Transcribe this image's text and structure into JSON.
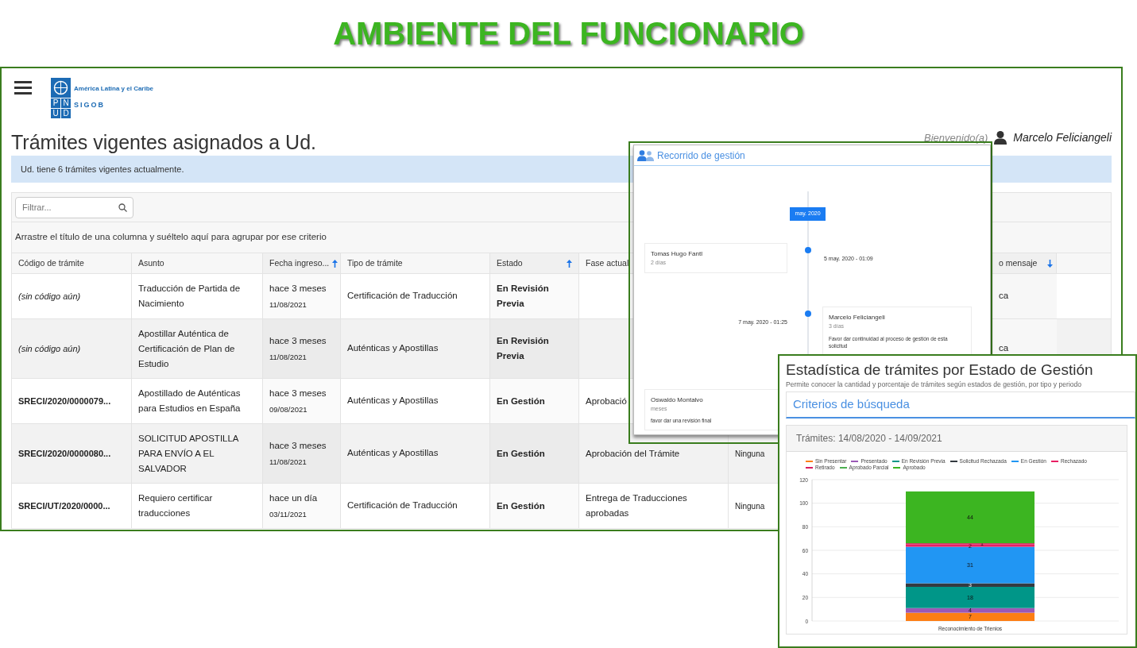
{
  "page_title": "AMBIENTE DEL FUNCIONARIO",
  "main_window": {
    "logo": {
      "letters": [
        "P",
        "N",
        "U",
        "D"
      ],
      "region": "América Latina y el Caribe",
      "brand": "SIGOB"
    },
    "heading": "Trámites vigentes asignados a Ud.",
    "welcome": {
      "greeting": "Bienvenido(a)",
      "user": "Marcelo Feliciangeli"
    },
    "alert": "Ud. tiene 6 trámites vigentes actualmente.",
    "filter": {
      "placeholder": "Filtrar..."
    },
    "group_hint": "Arrastre el título de una columna y suéltelo aquí para agrupar por ese criterio",
    "table": {
      "columns": [
        {
          "label": "Código de trámite",
          "sorted": false
        },
        {
          "label": "Asunto",
          "sorted": false
        },
        {
          "label": "Fecha ingreso...",
          "sorted": true,
          "descending": false
        },
        {
          "label": "Tipo de trámite",
          "sorted": false
        },
        {
          "label": "Estado",
          "sorted": true,
          "descending": false
        },
        {
          "label": "Fase actual"
        },
        {
          "label": "o mensaje",
          "sorted": true,
          "descending": true
        }
      ],
      "rows": [
        {
          "code": {
            "kind": "pending",
            "text": "(sin código aún)"
          },
          "subject": "Traducción de Partida de Nacimiento",
          "entered": {
            "relative": "hace 3 meses",
            "date": "11/08/2021"
          },
          "type": "Certificación de Traducción",
          "status": "En Revisión Previa",
          "column_8": "ca"
        },
        {
          "code": {
            "kind": "pending",
            "text": "(sin código aún)"
          },
          "subject": "Apostillar Auténtica de Certificación de Plan de Estudio",
          "entered": {
            "relative": "hace 3 meses",
            "date": "11/08/2021"
          },
          "type": "Auténticas y Apostillas",
          "status": "En Revisión Previa",
          "column_8": "ca"
        },
        {
          "code": {
            "kind": "code",
            "text": "SRECI/2020/0000079..."
          },
          "subject": "Apostillado de Auténticas para Estudios en España",
          "entered": {
            "relative": "hace 3 meses",
            "date": "09/08/2021"
          },
          "type": "Auténticas y Apostillas",
          "status": "En Gestión",
          "phase": "Aprobació"
        },
        {
          "code": {
            "kind": "code",
            "text": "SRECI/2020/0000080..."
          },
          "subject": "SOLICITUD APOSTILLA PARA ENVÍO A EL SALVADOR",
          "entered": {
            "relative": "hace 3 meses",
            "date": "11/08/2021"
          },
          "type": "Auténticas y Apostillas",
          "status": "En Gestión",
          "phase": "Aprobación del Trámite",
          "column_7": "Ninguna"
        },
        {
          "code": {
            "kind": "code",
            "text": "SRECI/UT/2020/0000..."
          },
          "subject": "Requiero certificar traducciones",
          "entered": {
            "relative": "hace un día",
            "date": "03/11/2021"
          },
          "type": "Certificación de Traducción",
          "status": "En Gestión",
          "phase": "Entrega de Traducciones aprobadas",
          "column_7": "Ninguna"
        }
      ]
    }
  },
  "timeline_window": {
    "title": "Recorrido de gestión",
    "month": "may. 2020",
    "entries": [
      {
        "card_on_right": false,
        "name": "Tomas Hugo Fantl",
        "duration": "2 días",
        "time": "5 may. 2020 - 01:09"
      },
      {
        "card_on_right": true,
        "name": "Marcelo Feliciangeli",
        "duration": "3 días",
        "note": "Favor dar continuidad al proceso de gestión de esta solicitud",
        "time": "7 may. 2020 - 01:25"
      },
      {
        "card_on_right": false,
        "name": "Oswaldo Montalvo",
        "duration": "meses",
        "note": "favor dar una revisión final"
      }
    ]
  },
  "stats_window": {
    "title": "Estadística de trámites por Estado de Gestión",
    "subtitle": "Permite conocer la cantidad y porcentaje de trámites según estados de gestión, por tipo y periodo",
    "criteria": "Criterios de búsqueda",
    "period": "Trámites: 14/08/2020 - 14/09/2021",
    "chart_data": {
      "type": "bar",
      "stacked": true,
      "grid": true,
      "legend": true,
      "data_labels": true,
      "categories": [
        "Reconocimiento de Trienios"
      ],
      "ylim": [
        0,
        120
      ],
      "yticks": [
        0,
        20,
        40,
        60,
        80,
        100,
        120
      ],
      "series": [
        {
          "name": "Sin Presentar",
          "color": "#fd7e14",
          "values": [
            7
          ]
        },
        {
          "name": "Presentado",
          "color": "#9b59b6",
          "values": [
            4
          ]
        },
        {
          "name": "En Revisión Previa",
          "color": "#009688",
          "values": [
            18
          ]
        },
        {
          "name": "Solicitud Rechazada",
          "color": "#343a40",
          "values": [
            3
          ]
        },
        {
          "name": "En Gestión",
          "color": "#2196f3",
          "values": [
            31
          ]
        },
        {
          "name": "Rechazado",
          "color": "#e91e63",
          "values": [
            2
          ]
        },
        {
          "name": "Retirado",
          "color": "#d81b60",
          "values": [
            1
          ]
        },
        {
          "name": "Aprobado Parcial",
          "color": "#4caf50",
          "values": [
            null
          ]
        },
        {
          "name": "Aprobado",
          "color": "#3cb521",
          "values": [
            44
          ]
        }
      ]
    }
  }
}
